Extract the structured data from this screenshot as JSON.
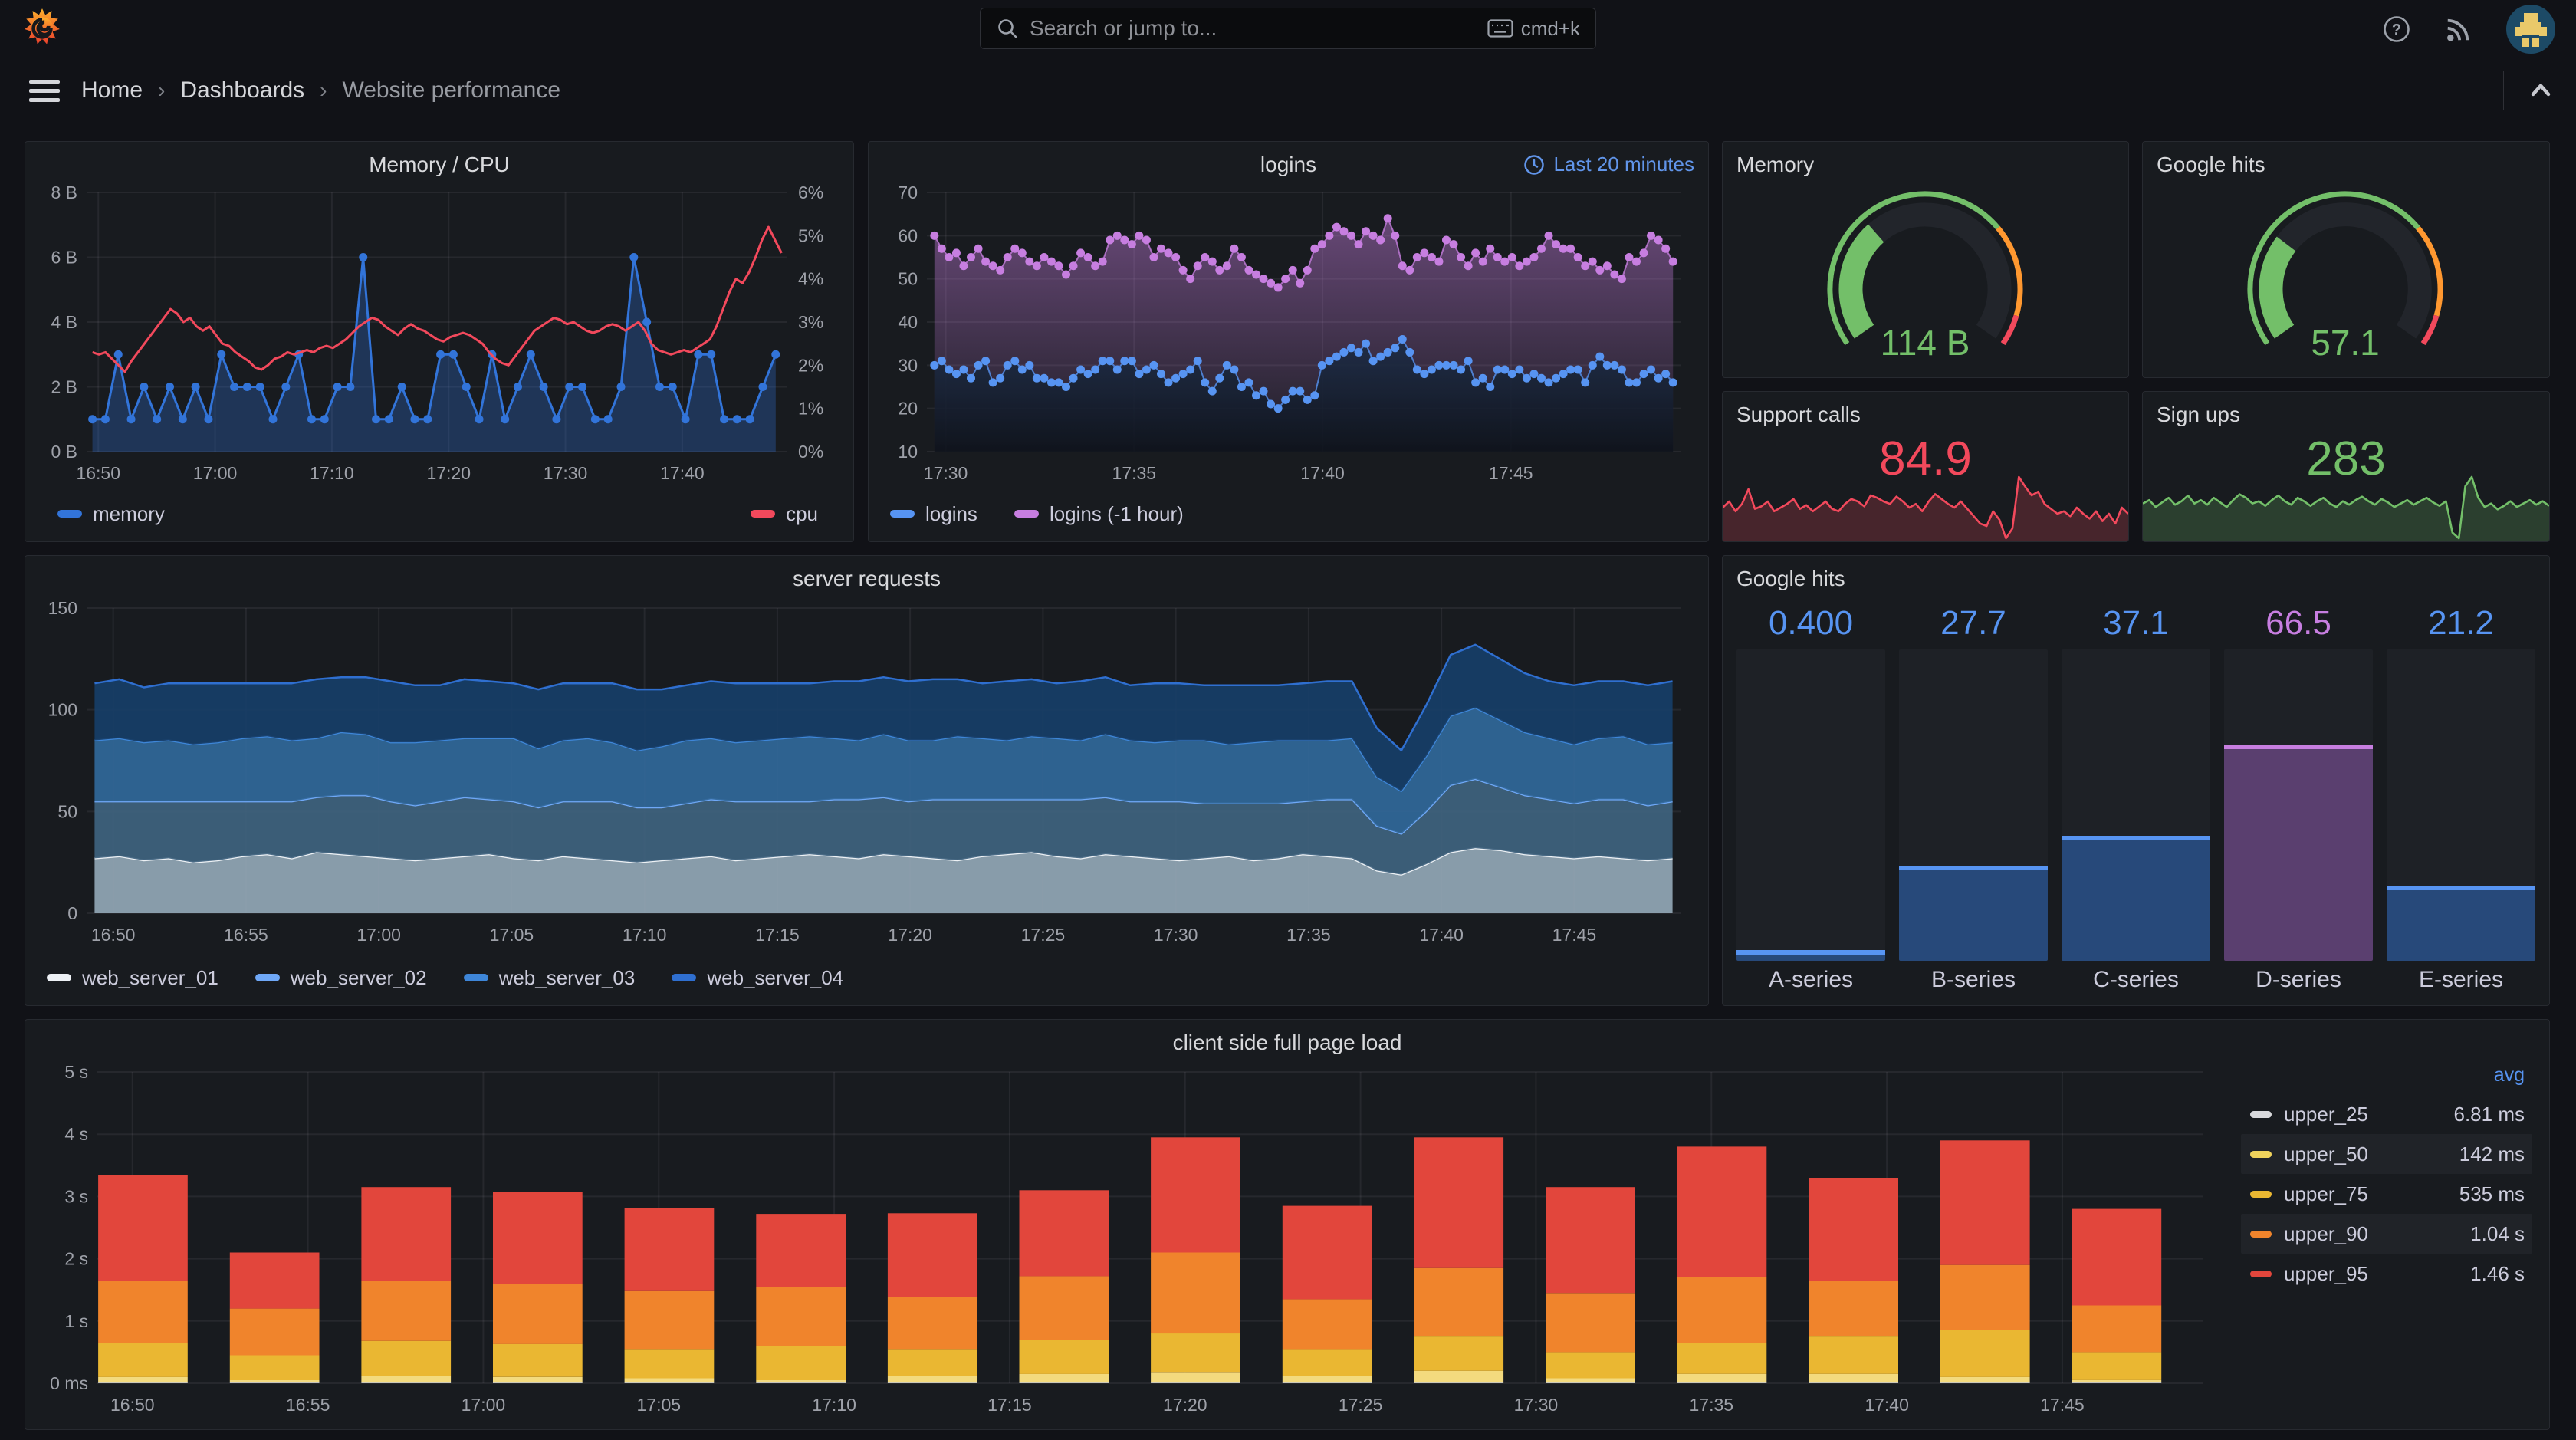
{
  "topnav": {
    "search_placeholder": "Search or jump to...",
    "search_shortcut": "cmd+k"
  },
  "breadcrumb": {
    "separator": "›",
    "items": [
      "Home",
      "Dashboards",
      "Website performance"
    ]
  },
  "colors": {
    "blue": "#3274D9",
    "light_blue": "#5794F2",
    "red": "#F2495C",
    "green": "#73BF69",
    "orange": "#FF9830",
    "purple": "#C77EE0",
    "text": "#CCCCDC"
  },
  "panels": {
    "mem_cpu": {
      "title": "Memory / CPU",
      "type": "line",
      "y_left_ticks": [
        "0 B",
        "2 B",
        "4 B",
        "6 B",
        "8 B"
      ],
      "y_right_ticks": [
        "0%",
        "1%",
        "2%",
        "3%",
        "4%",
        "5%",
        "6%"
      ],
      "x_ticks": [
        "16:50",
        "17:00",
        "17:10",
        "17:20",
        "17:30",
        "17:40"
      ],
      "series": [
        {
          "name": "memory",
          "color": "#3274D9",
          "values": [
            1,
            1,
            3,
            1,
            2,
            1,
            2,
            1,
            2,
            1,
            3,
            2,
            2,
            2,
            1,
            2,
            3,
            1,
            1,
            2,
            2,
            6,
            1,
            1,
            2,
            1,
            1,
            3,
            3,
            2,
            1,
            3,
            1,
            2,
            3,
            2,
            1,
            2,
            2,
            1,
            1,
            2,
            6,
            4,
            2,
            2,
            1,
            3,
            3,
            1,
            1,
            1,
            2,
            3
          ]
        },
        {
          "name": "cpu",
          "color": "#F2495C",
          "values": [
            2.3,
            2.25,
            2.3,
            2.15,
            2.0,
            1.85,
            2.1,
            2.3,
            2.5,
            2.7,
            2.9,
            3.1,
            3.3,
            3.2,
            3.0,
            3.1,
            2.9,
            2.8,
            2.9,
            2.7,
            2.5,
            2.45,
            2.3,
            2.2,
            2.1,
            1.95,
            1.9,
            2.0,
            2.15,
            2.2,
            2.3,
            2.25,
            2.3,
            2.35,
            2.3,
            2.4,
            2.45,
            2.4,
            2.5,
            2.6,
            2.75,
            2.9,
            3.0,
            3.1,
            3.05,
            2.9,
            2.8,
            2.7,
            2.85,
            2.95,
            2.85,
            2.8,
            2.7,
            2.6,
            2.55,
            2.65,
            2.7,
            2.75,
            2.7,
            2.6,
            2.5,
            2.3,
            2.15,
            2.05,
            2.0,
            2.2,
            2.4,
            2.6,
            2.8,
            2.9,
            3.0,
            3.1,
            3.05,
            2.95,
            3.0,
            2.9,
            2.8,
            2.75,
            2.8,
            2.9,
            2.95,
            2.9,
            2.8,
            2.9,
            3.0,
            2.8,
            2.5,
            2.35,
            2.3,
            2.25,
            2.3,
            2.35,
            2.3,
            2.4,
            2.5,
            2.6,
            2.9,
            3.3,
            3.7,
            4.0,
            3.9,
            4.15,
            4.5,
            4.9,
            5.2,
            4.9,
            4.6
          ]
        }
      ]
    },
    "logins": {
      "title": "logins",
      "type": "points",
      "time_range": "Last 20 minutes",
      "y_ticks": [
        "10",
        "20",
        "30",
        "40",
        "50",
        "60",
        "70"
      ],
      "x_ticks": [
        "17:30",
        "17:35",
        "17:40",
        "17:45"
      ],
      "series": [
        {
          "name": "logins",
          "color": "#5794F2",
          "values": [
            30,
            31,
            29,
            28,
            29,
            27,
            30,
            31,
            26,
            27,
            30,
            31,
            29,
            30,
            27,
            27,
            26,
            26,
            25,
            27,
            29,
            28,
            29,
            31,
            31,
            29,
            31,
            31,
            28,
            29,
            30,
            28,
            26,
            27,
            28,
            29,
            31,
            26,
            24,
            27,
            30,
            29,
            25,
            26,
            23,
            24,
            21,
            20,
            22,
            24,
            24,
            22,
            23,
            30,
            31,
            32,
            33,
            34,
            33,
            35,
            31,
            32,
            33,
            34,
            36,
            33,
            29,
            28,
            29,
            30,
            30,
            30,
            29,
            31,
            26,
            27,
            25,
            29,
            29,
            28,
            29,
            27,
            28,
            27,
            26,
            27,
            28,
            29,
            29,
            26,
            30,
            32,
            30,
            30,
            29,
            26,
            26,
            28,
            29,
            27,
            28,
            26
          ]
        },
        {
          "name": "logins (-1 hour)",
          "color": "#C77EE0",
          "values": [
            60,
            57,
            55,
            56,
            53,
            55,
            57,
            54,
            53,
            52,
            55,
            57,
            56,
            54,
            53,
            55,
            54,
            53,
            51,
            53,
            56,
            55,
            53,
            54,
            59,
            60,
            59,
            58,
            60,
            59,
            55,
            57,
            56,
            55,
            52,
            50,
            53,
            55,
            54,
            52,
            53,
            57,
            55,
            52,
            51,
            50,
            49,
            48,
            50,
            52,
            49,
            52,
            57,
            58,
            60,
            62,
            61,
            60,
            58,
            61,
            60,
            59,
            64,
            60,
            53,
            52,
            55,
            56,
            55,
            54,
            59,
            58,
            55,
            53,
            56,
            54,
            57,
            55,
            54,
            55,
            53,
            54,
            55,
            57,
            60,
            58,
            57,
            57,
            55,
            53,
            54,
            52,
            53,
            51,
            50,
            55,
            54,
            56,
            60,
            59,
            57,
            54
          ]
        }
      ]
    },
    "gauge_memory": {
      "title": "Memory",
      "value": "114 B",
      "fraction": 0.335,
      "value_color": "#73BF69",
      "thresholds": [
        {
          "to": 0.7,
          "color": "#73BF69"
        },
        {
          "to": 0.925,
          "color": "#FF9830"
        },
        {
          "to": 1,
          "color": "#F2495C"
        }
      ]
    },
    "gauge_google": {
      "title": "Google hits",
      "value": "57.1",
      "fraction": 0.29,
      "value_color": "#73BF69",
      "thresholds": [
        {
          "to": 0.7,
          "color": "#73BF69"
        },
        {
          "to": 0.925,
          "color": "#FF9830"
        },
        {
          "to": 1,
          "color": "#F2495C"
        }
      ]
    },
    "support_calls": {
      "title": "Support calls",
      "value": "84.9",
      "color": "#F2495C",
      "spark": [
        55,
        60,
        52,
        58,
        70,
        54,
        56,
        60,
        52,
        55,
        58,
        62,
        54,
        57,
        52,
        56,
        60,
        54,
        52,
        58,
        62,
        60,
        56,
        65,
        63,
        60,
        58,
        64,
        60,
        55,
        58,
        52,
        60,
        66,
        62,
        58,
        55,
        60,
        54,
        48,
        42,
        40,
        52,
        45,
        30,
        38,
        80,
        72,
        65,
        68,
        58,
        54,
        50,
        52,
        48,
        55,
        50,
        46,
        52,
        44,
        50,
        42,
        55,
        50
      ]
    },
    "sign_ups": {
      "title": "Sign ups",
      "value": "283",
      "color": "#73BF69",
      "spark": [
        55,
        58,
        52,
        56,
        60,
        54,
        57,
        62,
        55,
        58,
        54,
        60,
        56,
        52,
        58,
        63,
        60,
        55,
        57,
        53,
        58,
        62,
        57,
        54,
        60,
        57,
        53,
        57,
        60,
        55,
        52,
        57,
        54,
        58,
        61,
        57,
        54,
        59,
        56,
        52,
        55,
        58,
        54,
        57,
        60,
        56,
        53,
        57,
        30,
        25,
        70,
        78,
        60,
        52,
        55,
        50,
        53,
        57,
        52,
        55,
        58,
        54,
        57,
        53
      ]
    },
    "requests": {
      "title": "server requests",
      "type": "stacked-area",
      "y_ticks": [
        "0",
        "50",
        "100",
        "150"
      ],
      "x_ticks": [
        "16:50",
        "16:55",
        "17:00",
        "17:05",
        "17:10",
        "17:15",
        "17:20",
        "17:25",
        "17:30",
        "17:35",
        "17:40",
        "17:45"
      ],
      "series": [
        {
          "name": "web_server_01",
          "line": "#EDF1F5",
          "fill": "#93A7B6",
          "values": [
            27,
            28,
            26,
            27,
            25,
            26,
            28,
            29,
            27,
            30,
            29,
            28,
            27,
            26,
            27,
            28,
            29,
            27,
            26,
            28,
            27,
            26,
            25,
            26,
            27,
            28,
            26,
            27,
            28,
            29,
            28,
            27,
            29,
            28,
            27,
            26,
            28,
            29,
            30,
            28,
            27,
            29,
            28,
            27,
            26,
            27,
            28,
            26,
            27,
            29,
            28,
            27,
            21,
            19,
            24,
            30,
            32,
            31,
            29,
            28,
            27,
            28,
            27,
            26,
            27
          ]
        },
        {
          "name": "web_server_02",
          "line": "#6FA8F7",
          "fill": "#3F637F",
          "values": [
            28,
            27,
            29,
            28,
            30,
            29,
            27,
            26,
            28,
            27,
            29,
            30,
            28,
            27,
            28,
            29,
            27,
            28,
            26,
            27,
            28,
            29,
            27,
            26,
            27,
            28,
            29,
            28,
            27,
            26,
            28,
            29,
            28,
            27,
            29,
            30,
            28,
            27,
            26,
            28,
            29,
            28,
            27,
            28,
            29,
            27,
            26,
            28,
            27,
            26,
            28,
            29,
            22,
            20,
            26,
            33,
            34,
            31,
            29,
            28,
            27,
            28,
            29,
            27,
            28
          ]
        },
        {
          "name": "web_server_03",
          "line": "#3E86D8",
          "fill": "#31689A",
          "values": [
            30,
            31,
            29,
            30,
            28,
            29,
            31,
            32,
            30,
            29,
            31,
            30,
            29,
            31,
            30,
            29,
            30,
            31,
            29,
            30,
            31,
            29,
            28,
            30,
            31,
            30,
            29,
            30,
            31,
            32,
            30,
            29,
            31,
            30,
            29,
            31,
            30,
            29,
            31,
            30,
            29,
            31,
            30,
            29,
            30,
            31,
            29,
            30,
            31,
            30,
            29,
            30,
            24,
            21,
            27,
            34,
            35,
            33,
            31,
            30,
            29,
            30,
            31,
            30,
            29
          ]
        },
        {
          "name": "web_server_04",
          "line": "#2F6FD0",
          "fill": "#173E68",
          "values": [
            28,
            29,
            27,
            28,
            30,
            29,
            27,
            26,
            28,
            29,
            27,
            28,
            30,
            28,
            27,
            29,
            28,
            27,
            29,
            28,
            27,
            29,
            30,
            28,
            27,
            28,
            29,
            28,
            27,
            26,
            28,
            29,
            28,
            29,
            30,
            28,
            27,
            29,
            28,
            27,
            29,
            28,
            27,
            29,
            28,
            27,
            29,
            28,
            27,
            28,
            29,
            28,
            24,
            20,
            25,
            30,
            31,
            30,
            29,
            28,
            29,
            28,
            27,
            29,
            30
          ]
        }
      ]
    },
    "bar_gauge": {
      "title": "Google hits",
      "max": 100,
      "bars": [
        {
          "label": "A-series",
          "value": 0.4,
          "text": "0.400",
          "value_color": "#5794F2",
          "fill": "#27497A",
          "cap": "#5794F2"
        },
        {
          "label": "B-series",
          "value": 27.7,
          "text": "27.7",
          "value_color": "#5794F2",
          "fill": "#27497A",
          "cap": "#5794F2"
        },
        {
          "label": "C-series",
          "value": 37.1,
          "text": "37.1",
          "value_color": "#5794F2",
          "fill": "#27497A",
          "cap": "#5794F2"
        },
        {
          "label": "D-series",
          "value": 66.5,
          "text": "66.5",
          "value_color": "#C77EE0",
          "fill": "#5A3F6F",
          "cap": "#C77EE0"
        },
        {
          "label": "E-series",
          "value": 21.2,
          "text": "21.2",
          "value_color": "#5794F2",
          "fill": "#27497A",
          "cap": "#5794F2"
        }
      ]
    },
    "pageload": {
      "title": "client side full page load",
      "type": "stacked-bars",
      "y_ticks": [
        "0 ms",
        "1 s",
        "2 s",
        "3 s",
        "4 s",
        "5 s"
      ],
      "x_ticks": [
        "16:50",
        "16:55",
        "17:00",
        "17:05",
        "17:10",
        "17:15",
        "17:20",
        "17:25",
        "17:30",
        "17:35",
        "17:40",
        "17:45"
      ],
      "segment_colors": [
        "#DCDFE3",
        "#F3DA7E",
        "#EAB732",
        "#F0842C",
        "#E2463C"
      ],
      "bars": [
        {
          "segs": [
            0.01,
            0.1,
            0.65,
            1.65,
            3.35
          ]
        },
        {
          "segs": [
            0.01,
            0.05,
            0.45,
            1.2,
            2.1
          ]
        },
        {
          "segs": [
            0.01,
            0.12,
            0.68,
            1.65,
            3.15
          ]
        },
        {
          "segs": [
            0.01,
            0.1,
            0.63,
            1.6,
            3.07
          ]
        },
        {
          "segs": [
            0.01,
            0.08,
            0.55,
            1.48,
            2.82
          ]
        },
        {
          "segs": [
            0.01,
            0.05,
            0.6,
            1.55,
            2.72
          ]
        },
        {
          "segs": [
            0.01,
            0.12,
            0.55,
            1.38,
            2.73
          ]
        },
        {
          "segs": [
            0.01,
            0.15,
            0.7,
            1.72,
            3.1
          ]
        },
        {
          "segs": [
            0.01,
            0.18,
            0.8,
            2.1,
            3.95
          ]
        },
        {
          "segs": [
            0.01,
            0.12,
            0.55,
            1.35,
            2.85
          ]
        },
        {
          "segs": [
            0.01,
            0.2,
            0.75,
            1.85,
            3.95
          ]
        },
        {
          "segs": [
            0.01,
            0.08,
            0.5,
            1.45,
            3.15
          ]
        },
        {
          "segs": [
            0.01,
            0.15,
            0.65,
            1.7,
            3.8
          ]
        },
        {
          "segs": [
            0.01,
            0.15,
            0.75,
            1.65,
            3.3
          ]
        },
        {
          "segs": [
            0.01,
            0.1,
            0.85,
            1.9,
            3.9
          ]
        },
        {
          "segs": [
            0.01,
            0.05,
            0.5,
            1.25,
            2.8
          ]
        }
      ],
      "legend": {
        "header": "avg",
        "rows": [
          {
            "name": "upper_25",
            "value": "6.81 ms",
            "color": "#D8D9DC"
          },
          {
            "name": "upper_50",
            "value": "142 ms",
            "color": "#F0D35C"
          },
          {
            "name": "upper_75",
            "value": "535 ms",
            "color": "#EAB732"
          },
          {
            "name": "upper_90",
            "value": "1.04 s",
            "color": "#F0842C"
          },
          {
            "name": "upper_95",
            "value": "1.46 s",
            "color": "#E2463C"
          }
        ]
      }
    }
  }
}
